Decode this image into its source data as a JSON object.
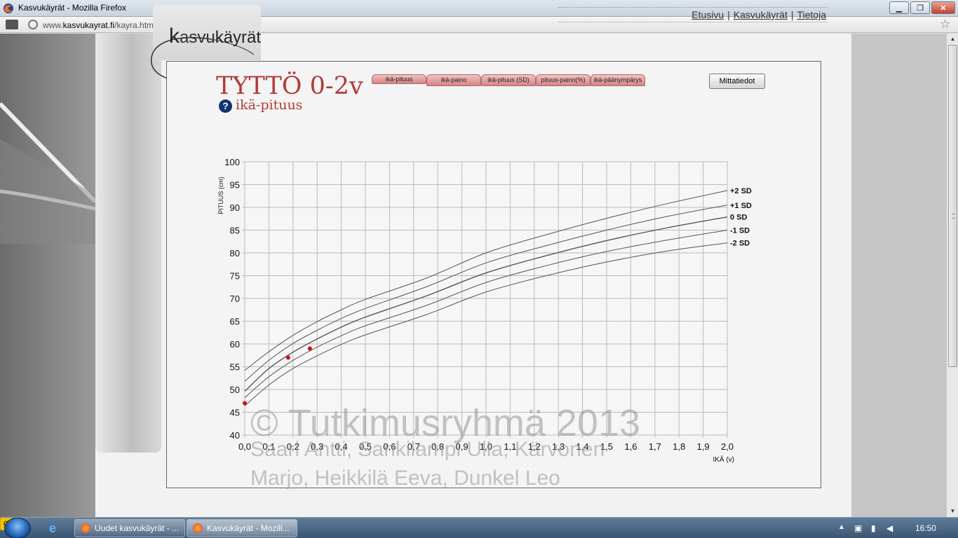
{
  "window": {
    "title": "Kasvukäyrät - Mozilla Firefox",
    "minimize": "▁",
    "maximize": "❐",
    "close": "✕"
  },
  "urlbar": {
    "url_prefix": "www.",
    "url_domain": "kasvukayrat.fi",
    "url_path": "/kayra.html"
  },
  "logo": {
    "k": "k",
    "part1": "asvu",
    "part2": "käyrät"
  },
  "topnav": {
    "links": [
      "Etusivu",
      "Kasvukäyrät",
      "Tietoja"
    ],
    "separator": "|"
  },
  "heading": {
    "title": "TYTTÖ 0-2v",
    "help": "?",
    "subtitle": "ikä-pituus"
  },
  "tabs": [
    "ikä-pituus",
    "ikä-paino",
    "ikä-pituus (SD)",
    "pituus-paino(%)",
    "ikä-päänympärys"
  ],
  "measurements_button": "Mittatiedot",
  "watermark": {
    "line1": "© Tutkimusryhmä 2013",
    "line2": "Saari Antti, Sankilampi Ulla, Kärvonen",
    "line3": "Marjo, Heikkilä Eeva, Dunkel Leo"
  },
  "chart_data": {
    "type": "line",
    "ylabel": "PITUUS (cm)",
    "xlabel": "IKÄ (v)",
    "xlim": [
      0,
      2
    ],
    "ylim": [
      40,
      100
    ],
    "x_ticks": [
      "0,0",
      "0,1",
      "0,2",
      "0,3",
      "0,4",
      "0,5",
      "0,6",
      "0,7",
      "0,8",
      "0,9",
      "1,0",
      "1,1",
      "1,2",
      "1,3",
      "1,4",
      "1,5",
      "1,6",
      "1,7",
      "1,8",
      "1,9",
      "2,0"
    ],
    "y_ticks": [
      "40",
      "45",
      "50",
      "55",
      "60",
      "65",
      "70",
      "75",
      "80",
      "85",
      "90",
      "95",
      "100"
    ],
    "grid": true,
    "series": [
      {
        "name": "+2 SD",
        "x": [
          0,
          0.1,
          0.2,
          0.3,
          0.4,
          0.5,
          0.75,
          1.0,
          1.25,
          1.5,
          1.75,
          2.0
        ],
        "y": [
          54.2,
          58.3,
          61.9,
          64.9,
          67.5,
          69.8,
          74.4,
          80.0,
          84.0,
          87.6,
          90.8,
          93.7
        ]
      },
      {
        "name": "+1 SD",
        "x": [
          0,
          0.1,
          0.2,
          0.3,
          0.4,
          0.5,
          0.75,
          1.0,
          1.25,
          1.5,
          1.75,
          2.0
        ],
        "y": [
          51.8,
          56.4,
          60.1,
          63.0,
          65.6,
          67.8,
          72.5,
          77.8,
          81.6,
          85.0,
          88.0,
          90.5
        ]
      },
      {
        "name": "0 SD",
        "x": [
          0,
          0.1,
          0.2,
          0.3,
          0.4,
          0.5,
          0.75,
          1.0,
          1.25,
          1.5,
          1.75,
          2.0
        ],
        "y": [
          49.6,
          54.6,
          58.2,
          61.1,
          63.7,
          65.9,
          70.5,
          75.6,
          79.4,
          82.7,
          85.5,
          87.9
        ]
      },
      {
        "name": "-1 SD",
        "x": [
          0,
          0.1,
          0.2,
          0.3,
          0.4,
          0.5,
          0.75,
          1.0,
          1.25,
          1.5,
          1.75,
          2.0
        ],
        "y": [
          48.2,
          52.8,
          56.4,
          59.3,
          61.8,
          64.0,
          68.4,
          73.5,
          77.2,
          80.3,
          82.8,
          85.0
        ]
      },
      {
        "name": "-2 SD",
        "x": [
          0,
          0.1,
          0.2,
          0.3,
          0.4,
          0.5,
          0.75,
          1.0,
          1.25,
          1.5,
          1.75,
          2.0
        ],
        "y": [
          46.4,
          51.0,
          54.6,
          57.4,
          59.9,
          62.0,
          66.4,
          71.4,
          75.0,
          78.0,
          80.4,
          82.2
        ]
      }
    ],
    "points": {
      "x": [
        0.0,
        0.18,
        0.27
      ],
      "y": [
        47.0,
        57.0,
        59.0
      ]
    },
    "colors": {
      "curve": "#555555",
      "point": "#cc1111",
      "grid": "#bbbbbb"
    }
  },
  "taskbar": {
    "tasks": [
      "Uudet kasvukäyrät - ...",
      "Kasvukäyrät - Mozill..."
    ],
    "outlook_letter": "O",
    "clock": "16:50"
  }
}
